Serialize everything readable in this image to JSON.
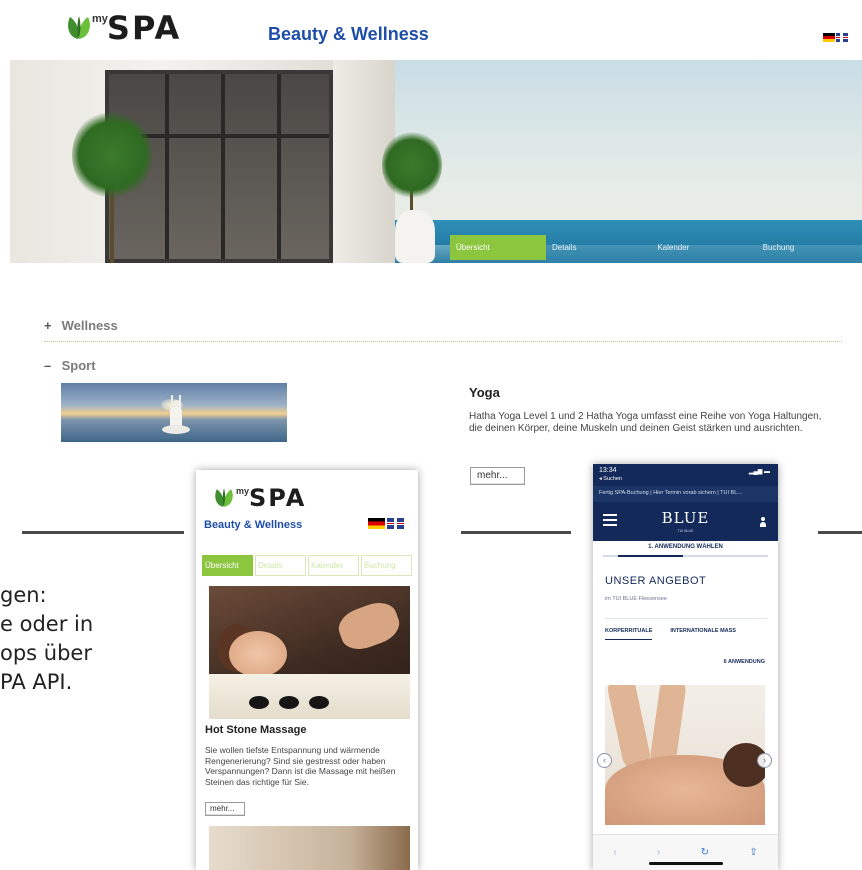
{
  "header": {
    "logo_my": "my",
    "logo_spa": "SPA",
    "tagline": "Beauty & Wellness"
  },
  "hero_nav": {
    "tabs": [
      {
        "label": "Übersicht",
        "active": true
      },
      {
        "label": "Details",
        "active": false
      },
      {
        "label": "Kalender",
        "active": false
      },
      {
        "label": "Buchung",
        "active": false
      }
    ]
  },
  "accordion": {
    "wellness": {
      "sign": "+",
      "label": "Wellness"
    },
    "sport": {
      "sign": "–",
      "label": "Sport"
    }
  },
  "yoga": {
    "title": "Yoga",
    "text": "Hatha Yoga Level 1 und 2 Hatha Yoga umfasst eine Reihe von Yoga Haltungen, die deinen Körper, deine Muskeln und deinen Geist stärken und ausrichten.",
    "more_label": "mehr..."
  },
  "behind_text": {
    "lines": [
      "gen:",
      "e oder in",
      "ops über",
      "PA API."
    ]
  },
  "phone_myspa": {
    "logo_my": "my",
    "logo_spa": "SPA",
    "tagline": "Beauty & Wellness",
    "tabs": [
      "Übersicht",
      "Details",
      "Kalender",
      "Buchung"
    ],
    "title": "Hot Stone Massage",
    "text": "Sie wollen tiefste Entspannung und wärmende Rengenerierung? Sind sie gestresst oder haben Verspannungen? Dann ist die Massage mit heißen Steinen das richtige für Sie.",
    "more_label": "mehr..."
  },
  "phone_tui": {
    "time": "13:34",
    "back_label": "◂ Suchen",
    "url_bar": "Fertig  SPA-Buchung | Hier Termin vorab sichern | TUI BL...",
    "brand": "BLUE",
    "brand_sub": "TUI BLUE",
    "step": "1. ANWENDUNG WÄHLEN",
    "heading": "UNSER ANGEBOT",
    "location": "im TUI BLUE Fleesensee",
    "categories": [
      "KÖRPERRITUALE",
      "INTERNATIONALE MASS"
    ],
    "count": "6 ANWENDUNG",
    "toolbar": [
      "‹",
      "›",
      "↻",
      "⇪"
    ]
  },
  "colors": {
    "accent_green": "#8cc63f",
    "brand_blue": "#1f4ea8",
    "tui_navy": "#13295a"
  }
}
